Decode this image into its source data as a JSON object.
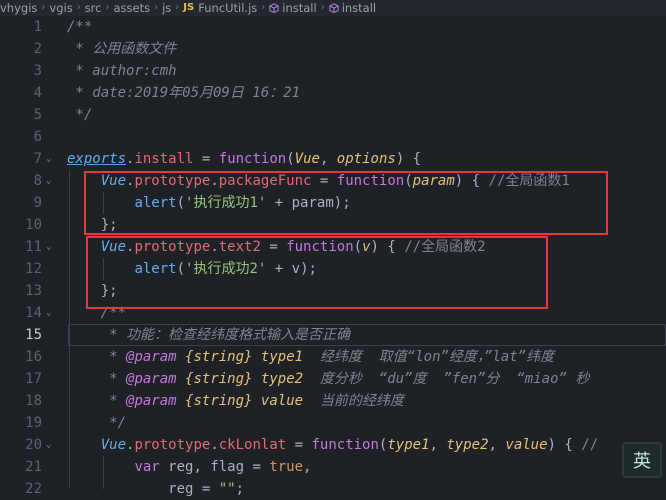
{
  "breadcrumb": {
    "items": [
      "vhygis",
      "vgis",
      "src",
      "assets",
      "js"
    ],
    "file_badge": "JS",
    "file": "FuncUtil.js",
    "symbols": [
      "install",
      "install"
    ]
  },
  "editor": {
    "active_line": 15,
    "line_numbers": [
      "1",
      "2",
      "3",
      "4",
      "5",
      "6",
      "7",
      "8",
      "9",
      "10",
      "11",
      "12",
      "13",
      "14",
      "15",
      "16",
      "17",
      "18",
      "19",
      "20",
      "21",
      "22"
    ]
  },
  "ime": {
    "label": "英"
  },
  "code": {
    "l1": "/**",
    "l2": " * 公用函数文件",
    "l3": " * author:cmh",
    "l4": " * date:2019年05月09日 16：21",
    "l5": " */",
    "l7": {
      "exports": "exports",
      "install": "install",
      "function": "function",
      "vue": "Vue",
      "options": "options"
    },
    "l8": {
      "vue": "Vue",
      "prototype": "prototype",
      "name": "packageFunc",
      "function": "function",
      "param": "param",
      "comment": "//全局函数1"
    },
    "l9": {
      "alert": "alert",
      "str": "'执行成功1'",
      "param": "param"
    },
    "l10": "};",
    "l11": {
      "vue": "Vue",
      "prototype": "prototype",
      "name": "text2",
      "function": "function",
      "param": "v",
      "comment": "//全局函数2"
    },
    "l12": {
      "alert": "alert",
      "str": "'执行成功2'",
      "param": "v"
    },
    "l13": "};",
    "l14": "/**",
    "l15": " * 功能：检查经纬度格式输入是否正确",
    "l16": {
      "tag": "@param",
      "type": "{string}",
      "name": "type1",
      "desc": "  经纬度  取值“lon”经度，”lat”纬度"
    },
    "l17": {
      "tag": "@param",
      "type": "{string}",
      "name": "type2",
      "desc": "  度分秒  “du”度  ”fen”分  “miao” 秒"
    },
    "l18": {
      "tag": "@param",
      "type": "{string}",
      "name": "value",
      "desc": "  当前的经纬度"
    },
    "l19": " */",
    "l20": {
      "vue": "Vue",
      "prototype": "prototype",
      "name": "ckLonlat",
      "function": "function",
      "p1": "type1",
      "p2": "type2",
      "p3": "value",
      "comment": "//"
    },
    "l21": {
      "var": "var",
      "vars": "reg, flag",
      "true": "true"
    },
    "l22": {
      "name": "reg",
      "str": "\"\""
    }
  },
  "colors": {
    "background": "#1e2227",
    "highlight_box": "#e53935",
    "keyword": "#c678dd",
    "string": "#98c379",
    "function": "#61afef",
    "property": "#e06c75",
    "parameter": "#e5c07b",
    "comment": "#7f848e"
  }
}
